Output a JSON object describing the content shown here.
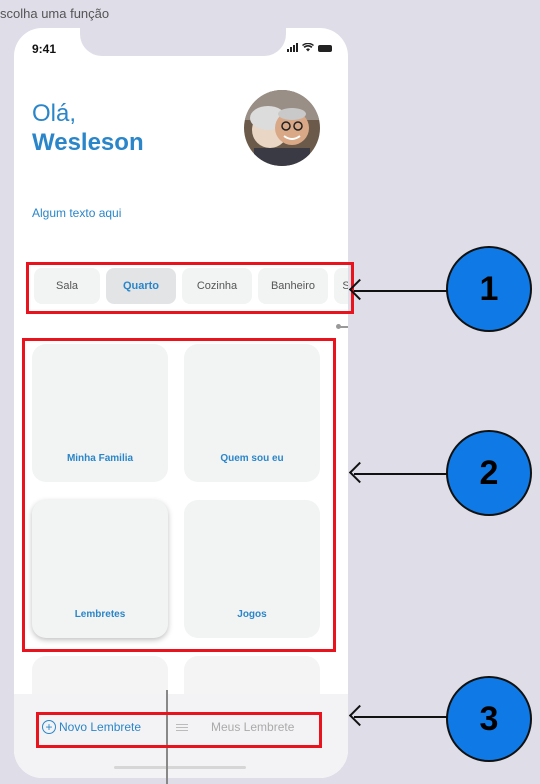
{
  "caption": "scolha uma função",
  "status": {
    "time": "9:41"
  },
  "greeting": {
    "hello": "Olá,",
    "name": "Wesleson"
  },
  "subtitle": "Algum texto aqui",
  "tabs": [
    {
      "label": "Sala",
      "active": false
    },
    {
      "label": "Quarto",
      "active": true
    },
    {
      "label": "Cozinha",
      "active": false
    },
    {
      "label": "Banheiro",
      "active": false
    },
    {
      "label": "S",
      "active": false
    }
  ],
  "cards": [
    {
      "label": "Minha Familia"
    },
    {
      "label": "Quem sou eu"
    },
    {
      "label": "Lembretes"
    },
    {
      "label": "Jogos"
    },
    {
      "label": ""
    },
    {
      "label": ""
    }
  ],
  "bottom_bar": {
    "new_label": "Novo Lembrete",
    "list_label": "Meus Lembrete"
  },
  "callouts": [
    "1",
    "2",
    "3"
  ],
  "colors": {
    "accent": "#2a86c9",
    "highlight": "#e8131d",
    "badge": "#0f7ae5"
  }
}
